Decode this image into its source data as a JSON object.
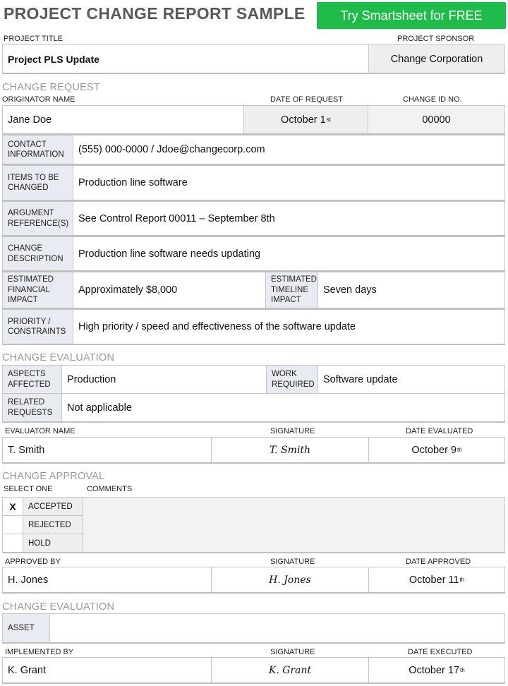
{
  "header": {
    "title": "PROJECT CHANGE REPORT SAMPLE",
    "cta": "Try Smartsheet for FREE"
  },
  "project": {
    "title_label": "PROJECT TITLE",
    "sponsor_label": "PROJECT SPONSOR",
    "title": "Project PLS Update",
    "sponsor": "Change Corporation"
  },
  "change_request": {
    "section": "CHANGE REQUEST",
    "originator_label": "ORIGINATOR NAME",
    "date_label": "DATE OF REQUEST",
    "id_label": "CHANGE ID NO.",
    "originator": "Jane Doe",
    "date": "October 1",
    "date_suffix": "st",
    "change_id": "00000",
    "contact_label_1": "CONTACT",
    "contact_label_2": "INFORMATION",
    "contact": "(555) 000-0000 / Jdoe@changecorp.com",
    "items_label_1": "ITEMS TO BE",
    "items_label_2": "CHANGED",
    "items": "Production line software",
    "argument_label_1": "ARGUMENT",
    "argument_label_2": "REFERENCE(S)",
    "argument": "See Control Report 00011 – September 8th",
    "description_label_1": "CHANGE",
    "description_label_2": "DESCRIPTION",
    "description": "Production line software needs updating",
    "financial_label_1": "ESTIMATED",
    "financial_label_2": "FINANCIAL",
    "financial_label_3": "IMPACT",
    "financial": "Approximately $8,000",
    "timeline_label_1": "ESTIMATED",
    "timeline_label_2": "TIMELINE",
    "timeline_label_3": "IMPACT",
    "timeline": "Seven days",
    "priority_label_1": "PRIORITY /",
    "priority_label_2": "CONSTRAINTS",
    "priority": "High priority / speed and effectiveness of the software update"
  },
  "evaluation": {
    "section": "CHANGE EVALUATION",
    "aspects_label_1": "ASPECTS",
    "aspects_label_2": "AFFECTED",
    "aspects": "Production",
    "work_label_1": "WORK",
    "work_label_2": "REQUIRED",
    "work": "Software update",
    "related_label_1": "RELATED",
    "related_label_2": "REQUESTS",
    "related": "Not applicable",
    "evaluator_label": "EVALUATOR NAME",
    "signature_label": "SIGNATURE",
    "date_label": "DATE EVALUATED",
    "evaluator": "T. Smith",
    "signature": "T. Smith",
    "date": "October 9",
    "date_suffix": "th"
  },
  "approval": {
    "section": "CHANGE APPROVAL",
    "select_label": "SELECT ONE",
    "comments_label": "COMMENTS",
    "options": [
      {
        "mark": "X",
        "label": "ACCEPTED"
      },
      {
        "mark": "",
        "label": "REJECTED"
      },
      {
        "mark": "",
        "label": "HOLD"
      }
    ],
    "comments": "",
    "approved_label": "APPROVED BY",
    "signature_label": "SIGNATURE",
    "date_label": "DATE APPROVED",
    "approver": "H. Jones",
    "signature": "H. Jones",
    "date": "October 11",
    "date_suffix": "th"
  },
  "implementation": {
    "section": "CHANGE EVALUATION",
    "asset_label": "ASSET",
    "asset": "",
    "implemented_label": "IMPLEMENTED BY",
    "signature_label": "SIGNATURE",
    "date_label": "DATE EXECUTED",
    "implementer": "K. Grant",
    "signature": "K. Grant",
    "date": "October 17",
    "date_suffix": "th"
  }
}
